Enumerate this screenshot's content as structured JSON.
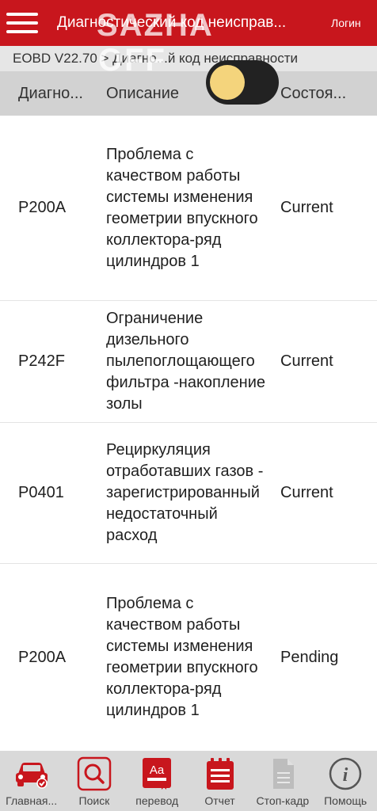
{
  "header": {
    "title": "Диагностический код неисправ...",
    "login_label": "Логин",
    "menu_icon": "hamburger-menu-icon"
  },
  "breadcrumb": "EOBD V22.70 > Диагно...й код неисправности",
  "watermark": {
    "line1": "SAZHA",
    "line2": "OFF"
  },
  "table": {
    "headers": {
      "code": "Диагно...",
      "description": "Описание",
      "state": "Состоя..."
    },
    "rows": [
      {
        "code": "P200A",
        "description": "Проблема с качеством работы системы изменения геометрии впускного коллектора-ряд цилиндров 1",
        "state": "Current"
      },
      {
        "code": "P242F",
        "description": "Ограничение дизельного пылепоглощающего фильтра -накопление золы",
        "state": "Current"
      },
      {
        "code": "P0401",
        "description": "Рециркуляция отработавших газов - зарегистрированный недостаточный расход",
        "state": "Current"
      },
      {
        "code": "P200A",
        "description": "Проблема с качеством работы системы изменения геометрии впускного коллектора-ряд цилиндров 1",
        "state": "Pending"
      }
    ]
  },
  "bottom_nav": [
    {
      "label": "Главная...",
      "icon": "car-home-icon"
    },
    {
      "label": "Поиск",
      "icon": "search-icon"
    },
    {
      "label": "перевод",
      "icon": "translate-icon"
    },
    {
      "label": "Отчет",
      "icon": "report-icon"
    },
    {
      "label": "Стоп-кадр",
      "icon": "freeze-frame-icon"
    },
    {
      "label": "Помощь",
      "icon": "help-icon"
    }
  ],
  "colors": {
    "accent": "#c8161d",
    "toggle_knob": "#f4d47c"
  }
}
